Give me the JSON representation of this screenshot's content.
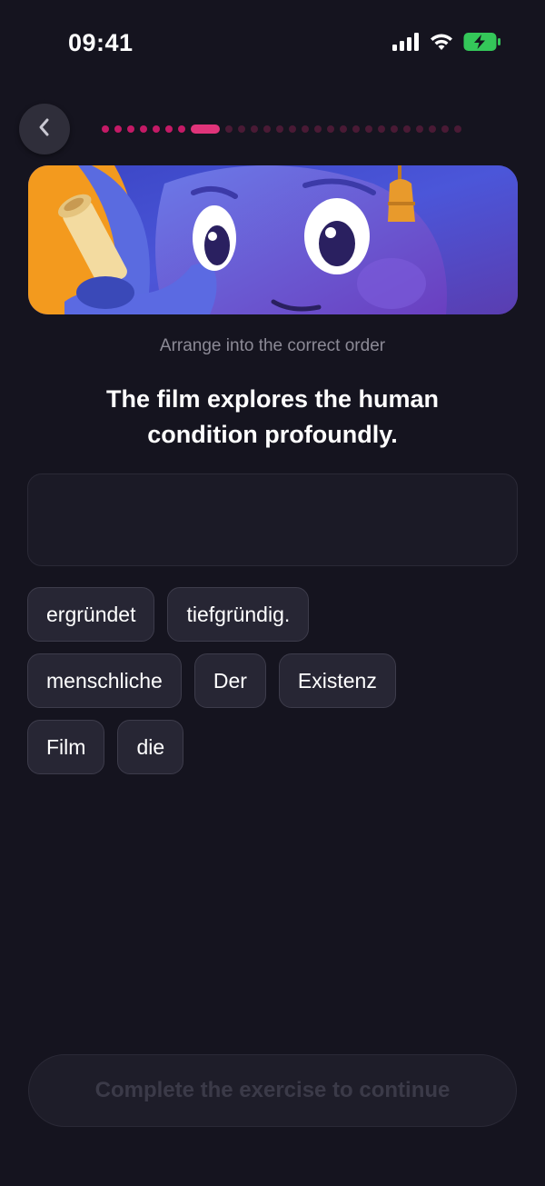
{
  "status_bar": {
    "time": "09:41"
  },
  "progress": {
    "current_index": 8,
    "total_steps": 27
  },
  "exercise": {
    "instruction": "Arrange into the correct order",
    "prompt": "The film explores the human condition profoundly.",
    "answer_words": []
  },
  "word_bank": {
    "rows": [
      [
        "ergründet",
        "tiefgründig."
      ],
      [
        "menschliche",
        "Der",
        "Existenz"
      ],
      [
        "Film",
        "die"
      ]
    ]
  },
  "footer": {
    "continue_label": "Complete the exercise to continue"
  },
  "colors": {
    "background": "#15141f",
    "progress_done": "#c41a66",
    "progress_current": "#e0347a",
    "progress_todo": "#4a1a35",
    "battery": "#34c759"
  },
  "icons": [
    "signal-icon",
    "wifi-icon",
    "battery-charging-icon",
    "chevron-left-icon"
  ]
}
